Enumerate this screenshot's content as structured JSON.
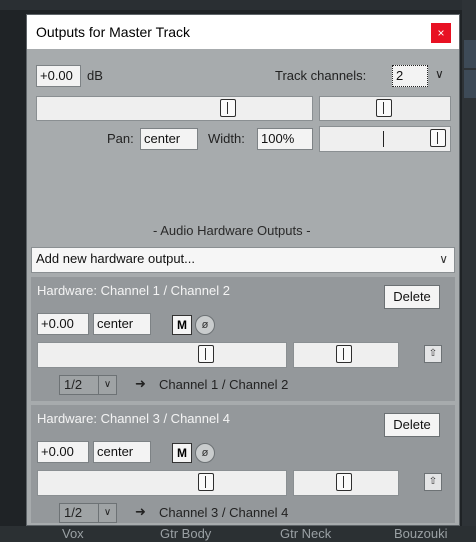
{
  "window": {
    "title": "Outputs for Master Track",
    "close_label": "×"
  },
  "master": {
    "volume_value": "+0.00",
    "volume_unit": "dB",
    "track_channels_label": "Track channels:",
    "track_channels_value": "2",
    "pan_label": "Pan:",
    "pan_value": "center",
    "width_label": "Width:",
    "width_value": "100%"
  },
  "hardware_outputs": {
    "section_label": "- Audio Hardware Outputs -",
    "add_output_label": "Add new hardware output...",
    "outputs": [
      {
        "title": "Hardware: Channel 1 / Channel 2",
        "delete_label": "Delete",
        "volume_value": "+0.00",
        "pan_value": "center",
        "mute_label": "M",
        "phase_label": "ø",
        "channel_select": "1/2",
        "arrow": "➜",
        "destination": "Channel 1 / Channel 2"
      },
      {
        "title": "Hardware: Channel 3 / Channel 4",
        "delete_label": "Delete",
        "volume_value": "+0.00",
        "pan_value": "center",
        "mute_label": "M",
        "phase_label": "ø",
        "channel_select": "1/2",
        "arrow": "➜",
        "destination": "Channel 3 / Channel 4"
      }
    ]
  },
  "background_tracks": [
    "Vox",
    "Gtr Body",
    "Gtr Neck",
    "Bouzouki"
  ]
}
